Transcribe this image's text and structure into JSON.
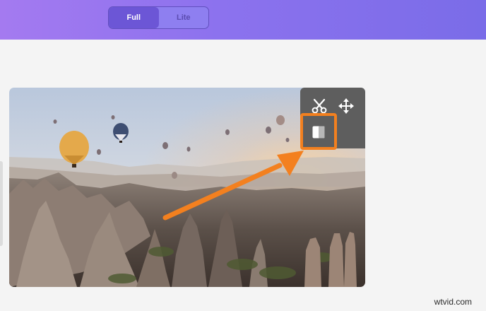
{
  "toggle": {
    "full_label": "Full",
    "lite_label": "Lite",
    "selected": "Full"
  },
  "media": {
    "subject": "hot-air-balloons-over-valley"
  },
  "tools": [
    {
      "name": "cut",
      "icon": "scissors-icon"
    },
    {
      "name": "move",
      "icon": "move-arrows-icon"
    },
    {
      "name": "compare",
      "icon": "split-view-icon",
      "highlighted": true
    }
  ],
  "callout": {
    "color": "#f3801f"
  },
  "watermark": {
    "text": "wtvid.com"
  }
}
